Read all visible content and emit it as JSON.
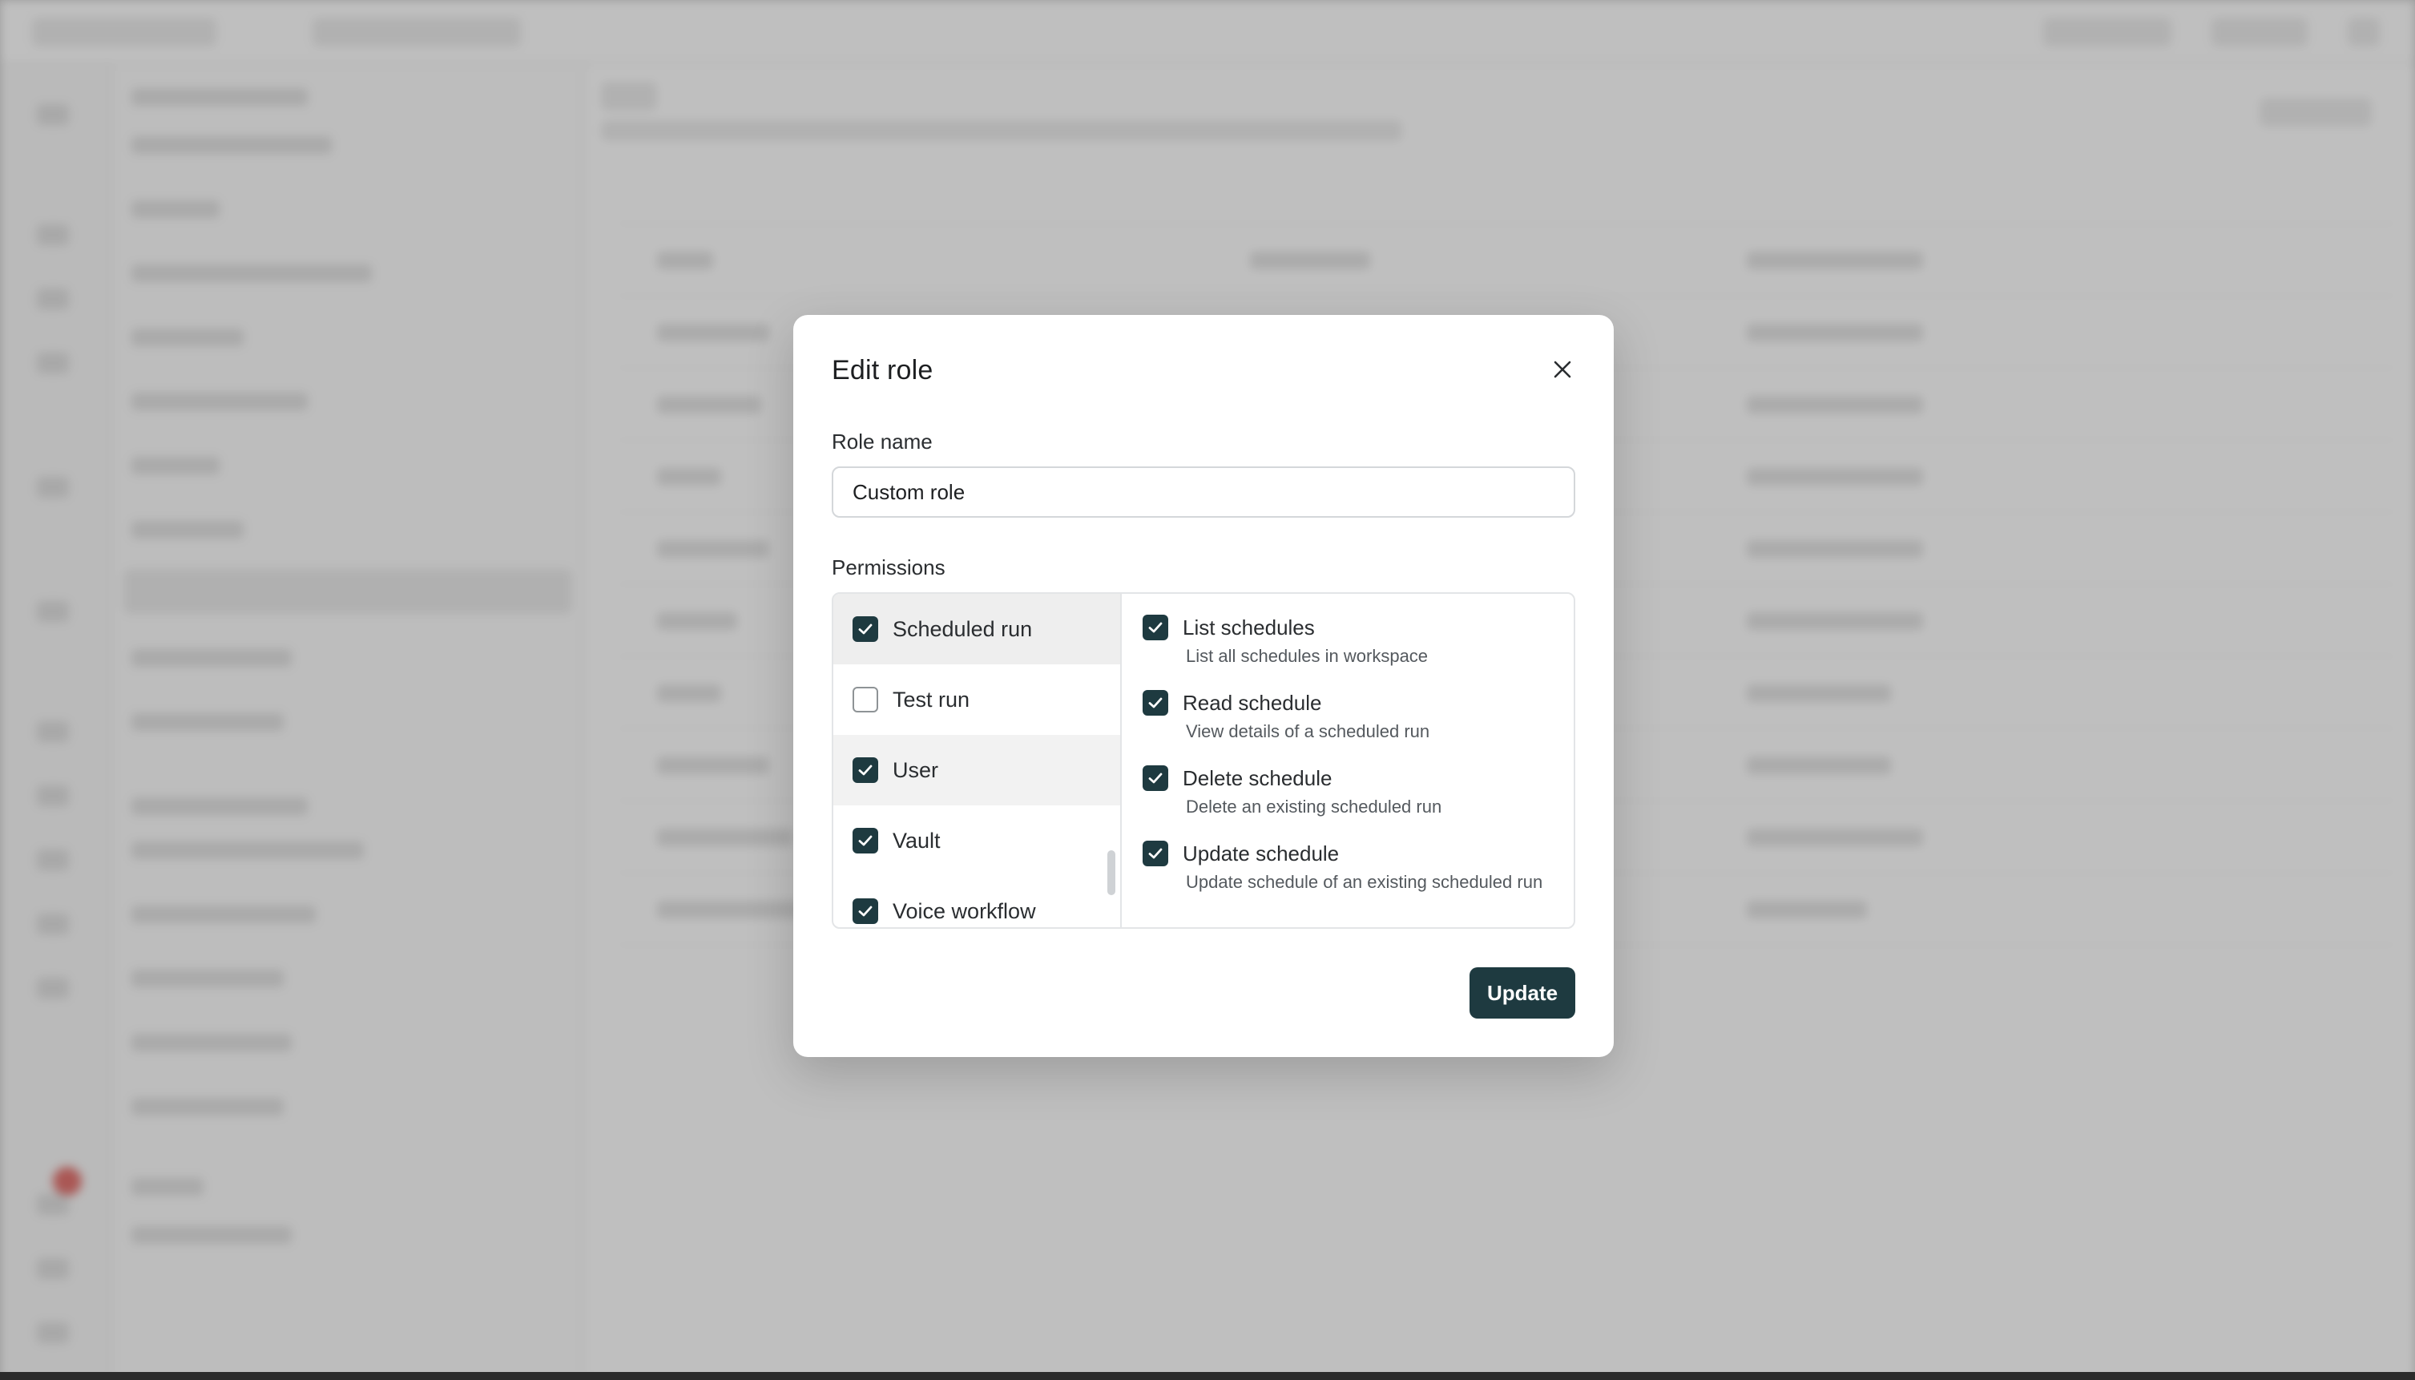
{
  "dialog": {
    "title": "Edit role",
    "role_name_label": "Role name",
    "role_name_value": "Custom role",
    "permissions_label": "Permissions",
    "update_label": "Update"
  },
  "categories": [
    {
      "label": "Scheduled run",
      "checked": true,
      "selected": true
    },
    {
      "label": "Test run",
      "checked": false,
      "selected": false
    },
    {
      "label": "User",
      "checked": true,
      "selected": false
    },
    {
      "label": "Vault",
      "checked": true,
      "selected": false
    },
    {
      "label": "Voice workflow",
      "checked": true,
      "selected": false
    }
  ],
  "permissions": [
    {
      "name": "List schedules",
      "description": "List all schedules in workspace",
      "checked": true
    },
    {
      "name": "Read schedule",
      "description": "View details of a scheduled run",
      "checked": true
    },
    {
      "name": "Delete schedule",
      "description": "Delete an existing scheduled run",
      "checked": true
    },
    {
      "name": "Update schedule",
      "description": "Update schedule of an existing scheduled run",
      "checked": true
    }
  ],
  "icons": {
    "close": "close-icon",
    "check": "check-icon"
  },
  "colors": {
    "accent": "#1e3a40",
    "overlay": "#5f5f5f"
  }
}
